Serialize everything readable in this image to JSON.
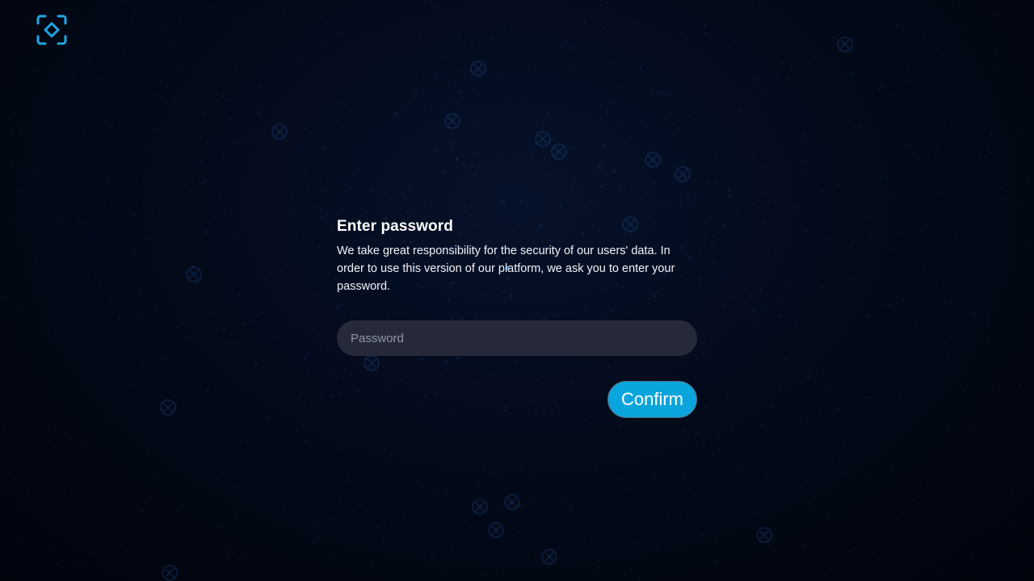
{
  "logo": {
    "icon": "scan-frame-icon",
    "color": "#1ea7e4"
  },
  "dialog": {
    "title": "Enter password",
    "description": "We take great responsibility for the security of our users' data. In order to use this version of our platform, we ask you to enter your password.",
    "password_placeholder": "Password",
    "password_value": "",
    "confirm_label": "Confirm"
  },
  "colors": {
    "background": "#01040d",
    "accent": "#0aa5dc",
    "input_bg": "#262a38"
  }
}
